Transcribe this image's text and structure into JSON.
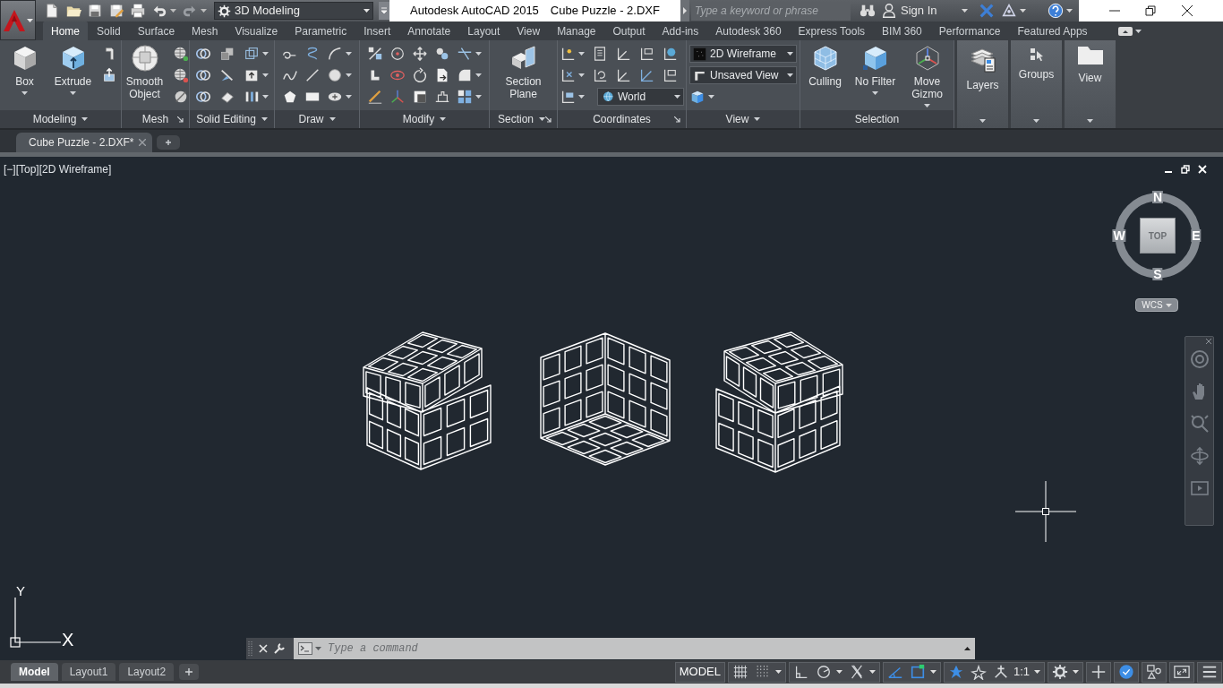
{
  "quick_access": {
    "workspace": "3D Modeling"
  },
  "title_bar": {
    "app": "Autodesk AutoCAD 2015",
    "document": "Cube Puzzle - 2.DXF"
  },
  "search": {
    "placeholder": "Type a keyword or phrase"
  },
  "account": {
    "label": "Sign In"
  },
  "ribbon_tabs": [
    {
      "label": "Home",
      "selected": true
    },
    {
      "label": "Solid",
      "selected": false
    },
    {
      "label": "Surface",
      "selected": false
    },
    {
      "label": "Mesh",
      "selected": false
    },
    {
      "label": "Visualize",
      "selected": false
    },
    {
      "label": "Parametric",
      "selected": false
    },
    {
      "label": "Insert",
      "selected": false
    },
    {
      "label": "Annotate",
      "selected": false
    },
    {
      "label": "Layout",
      "selected": false
    },
    {
      "label": "View",
      "selected": false
    },
    {
      "label": "Manage",
      "selected": false
    },
    {
      "label": "Output",
      "selected": false
    },
    {
      "label": "Add-ins",
      "selected": false
    },
    {
      "label": "Autodesk 360",
      "selected": false
    },
    {
      "label": "Express Tools",
      "selected": false
    },
    {
      "label": "BIM 360",
      "selected": false
    },
    {
      "label": "Performance",
      "selected": false
    },
    {
      "label": "Featured Apps",
      "selected": false
    }
  ],
  "ribbon_panels": [
    {
      "title": "Modeling",
      "menu": true,
      "launcher": false,
      "large_tools": [
        {
          "label": "Box",
          "menu": true
        },
        {
          "label": "Extrude",
          "menu": true
        }
      ]
    },
    {
      "title": "Mesh",
      "menu": false,
      "launcher": true,
      "large_tools": [
        {
          "label": "Smooth Object",
          "menu": false
        }
      ]
    },
    {
      "title": "Solid Editing",
      "menu": true,
      "launcher": false
    },
    {
      "title": "Draw",
      "menu": true,
      "launcher": false
    },
    {
      "title": "Modify",
      "menu": true,
      "launcher": false
    },
    {
      "title": "Section",
      "menu": true,
      "launcher": true,
      "large_tools": [
        {
          "label": "Section Plane",
          "menu": false
        }
      ]
    },
    {
      "title": "Coordinates",
      "menu": false,
      "launcher": true,
      "dropdowns": [
        {
          "value": "World"
        }
      ]
    },
    {
      "title": "View",
      "menu": true,
      "launcher": false,
      "dropdowns": [
        {
          "value": "2D Wireframe"
        },
        {
          "value": "Unsaved View"
        }
      ]
    },
    {
      "title": "Selection",
      "menu": false,
      "launcher": false,
      "large_tools": [
        {
          "label": "Culling",
          "menu": false
        },
        {
          "label": "No Filter",
          "menu": true
        },
        {
          "label": "Move Gizmo",
          "menu": true
        }
      ]
    }
  ],
  "collapsed_panels": [
    {
      "label": "Layers"
    },
    {
      "label": "Groups"
    },
    {
      "label": "View"
    }
  ],
  "file_tabs": [
    {
      "label": "Cube Puzzle - 2.DXF*",
      "selected": true
    }
  ],
  "viewport": {
    "controls": "[−][Top][2D Wireframe]"
  },
  "viewcube": {
    "north": "N",
    "west": "W",
    "east": "E",
    "south": "S",
    "face": "TOP",
    "coordinate_system": "WCS"
  },
  "ucs_icon": {
    "y": "Y",
    "x": "X"
  },
  "command_line": {
    "placeholder": "Type a command"
  },
  "layout_tabs": [
    {
      "label": "Model",
      "selected": true
    },
    {
      "label": "Layout1",
      "selected": false
    },
    {
      "label": "Layout2",
      "selected": false
    }
  ],
  "status_bar": {
    "groups": [
      [
        {
          "kind": "text",
          "label": "MODEL"
        }
      ],
      [
        {
          "kind": "grid",
          "on": false
        },
        {
          "kind": "snap",
          "on": false,
          "menu": true
        }
      ],
      [
        {
          "kind": "ortho",
          "on": false
        },
        {
          "kind": "polar",
          "on": false,
          "menu": true
        },
        {
          "kind": "isodraft",
          "on": false,
          "menu": true
        }
      ],
      [
        {
          "kind": "dynamic_ucs",
          "on": true
        },
        {
          "kind": "selection_filter",
          "on": true,
          "menu": true
        }
      ],
      [
        {
          "kind": "annotation_visibility",
          "on": true
        },
        {
          "kind": "auto_scale",
          "on": false
        },
        {
          "kind": "annotation_scale",
          "label": "1:1",
          "menu": true
        }
      ],
      [
        {
          "kind": "workspace",
          "menu": true
        }
      ],
      [
        {
          "kind": "plus"
        }
      ],
      [
        {
          "kind": "isolate",
          "on": true
        }
      ],
      [
        {
          "kind": "shapes"
        }
      ],
      [
        {
          "kind": "clean_screen"
        }
      ],
      [
        {
          "kind": "customize"
        }
      ]
    ]
  }
}
